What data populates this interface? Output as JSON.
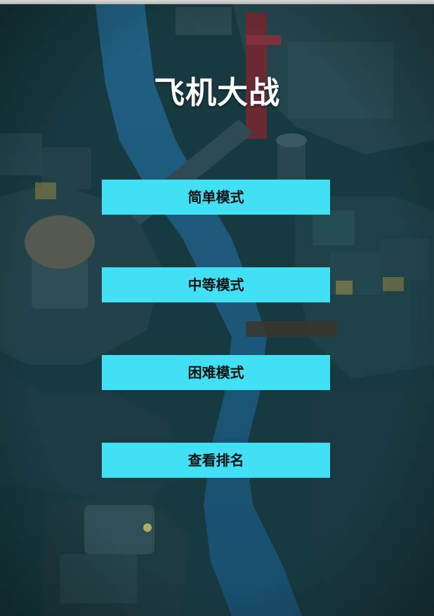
{
  "game": {
    "title": "飞机大战"
  },
  "menu": {
    "easy_label": "简单模式",
    "medium_label": "中等模式",
    "hard_label": "困难模式",
    "ranking_label": "查看排名"
  },
  "colors": {
    "button_bg": "#41e0f4",
    "button_text": "#111111",
    "title_text": "#ffffff"
  }
}
